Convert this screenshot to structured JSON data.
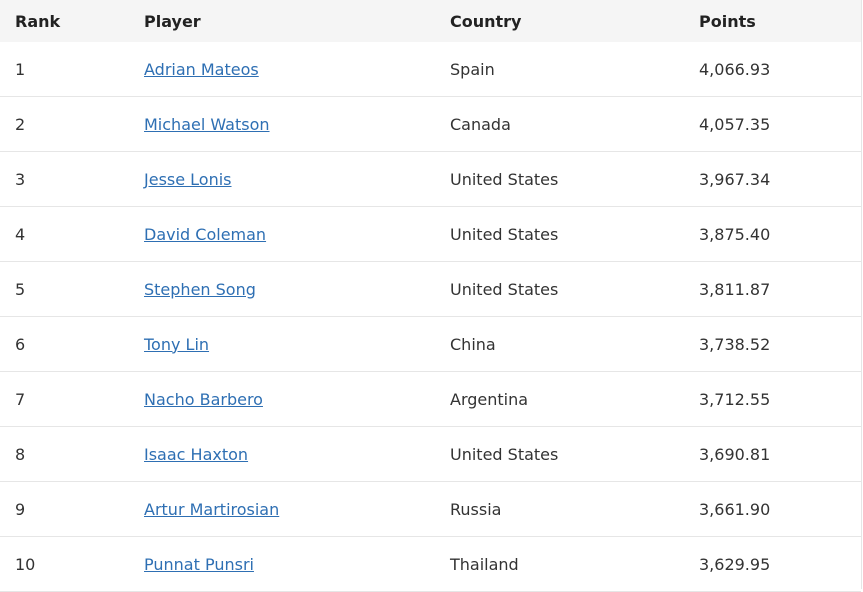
{
  "headers": {
    "rank": "Rank",
    "player": "Player",
    "country": "Country",
    "points": "Points"
  },
  "rows": [
    {
      "rank": "1",
      "player": "Adrian Mateos",
      "country": "Spain",
      "points": "4,066.93"
    },
    {
      "rank": "2",
      "player": "Michael Watson",
      "country": "Canada",
      "points": "4,057.35"
    },
    {
      "rank": "3",
      "player": "Jesse Lonis",
      "country": "United States",
      "points": "3,967.34"
    },
    {
      "rank": "4",
      "player": "David Coleman",
      "country": "United States",
      "points": "3,875.40"
    },
    {
      "rank": "5",
      "player": "Stephen Song",
      "country": "United States",
      "points": "3,811.87"
    },
    {
      "rank": "6",
      "player": "Tony Lin",
      "country": "China",
      "points": "3,738.52"
    },
    {
      "rank": "7",
      "player": "Nacho Barbero",
      "country": "Argentina",
      "points": "3,712.55"
    },
    {
      "rank": "8",
      "player": "Isaac Haxton",
      "country": "United States",
      "points": "3,690.81"
    },
    {
      "rank": "9",
      "player": "Artur Martirosian",
      "country": "Russia",
      "points": "3,661.90"
    },
    {
      "rank": "10",
      "player": "Punnat Punsri",
      "country": "Thailand",
      "points": "3,629.95"
    }
  ],
  "colors": {
    "link": "#2e6fb3",
    "header_bg": "#f5f5f5"
  }
}
